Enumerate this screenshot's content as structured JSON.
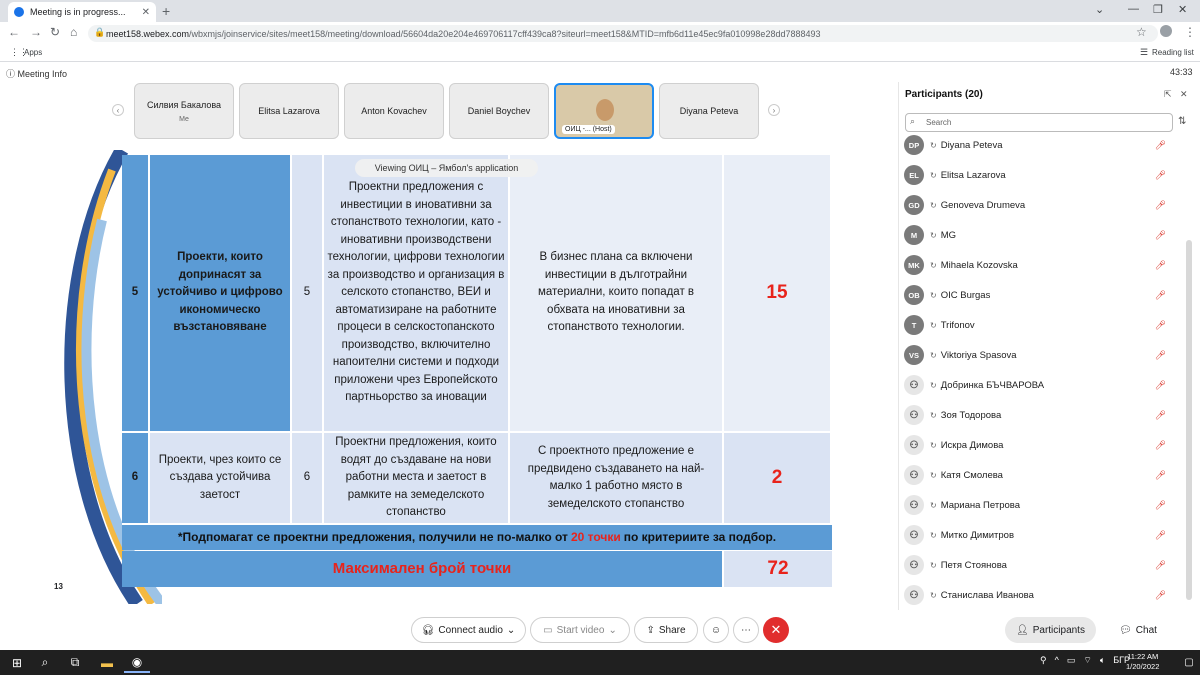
{
  "browser": {
    "tab_title": "Meeting is in progress...",
    "url_host": "meet158.webex.com",
    "url_path": "/wbxmjs/joinservice/sites/meet158/meeting/download/56604da20e204e469706117cff439ca8?siteurl=meet158&MTID=mfb6d11e45ec9fa010998e28dd7888493",
    "bookmarks_apps": "Apps",
    "reading_list": "Reading list"
  },
  "meeting": {
    "info_label": "Meeting Info",
    "timer": "43:33",
    "viewing_banner": "Viewing ОИЦ – Ямбол's application"
  },
  "thumbnails": [
    {
      "name": "Силвия Бакалова",
      "sub": "Me"
    },
    {
      "name": "Elitsa Lazarova",
      "sub": ""
    },
    {
      "name": "Anton Kovachev",
      "sub": ""
    },
    {
      "name": "Daniel Boychev",
      "sub": ""
    },
    {
      "name": "ОИЦ -... (Host)",
      "sub": ""
    },
    {
      "name": "Diyana Peteva",
      "sub": ""
    }
  ],
  "slide": {
    "row5": {
      "num": "5",
      "title": "Проекти, които допринасят за устойчиво и цифрово икономическо възстановяване",
      "sub": "5",
      "top_fragment": "Проектни предложения с",
      "desc": "инвестиции в иновативни за стопанството технологии, като - иновативни производствени технологии, цифрови технологии за производство и организация в селското стопанство, ВЕИ и автоматизиране на работните процеси в селскостопанското производство, включително напоителни системи и подходи приложени чрез Европейското партньорство за иновации",
      "condition": "В бизнес плана са включени инвестиции в дълготрайни материални, които попадат в обхвата на иновативни за стопанството технологии.",
      "points": "15"
    },
    "row6": {
      "num": "6",
      "title": "Проекти, чрез които се създава устойчива заетост",
      "sub": "6",
      "desc": "Проектни предложения, които водят до създаване на нови работни места и заетост в рамките на земеделското стопанство",
      "condition": "С проектното предложение е предвидено създаването на най-малко 1 работно място в земеделското стопанство",
      "points": "2"
    },
    "note_before": "*Подпомагат се проектни предложения, получили не по-малко от ",
    "note_highlight": "20 точки",
    "note_after": " по критериите за подбор.",
    "max_label": "Максимален брой точки",
    "max_value": "72",
    "page_number": "13"
  },
  "participants": {
    "title": "Participants (20)",
    "search_placeholder": "Search",
    "list": [
      {
        "initials": "DP",
        "name": "Diyana Peteva",
        "guest": false
      },
      {
        "initials": "EL",
        "name": "Elitsa Lazarova",
        "guest": false
      },
      {
        "initials": "GD",
        "name": "Genoveva Drumeva",
        "guest": false
      },
      {
        "initials": "M",
        "name": "MG",
        "guest": false
      },
      {
        "initials": "MK",
        "name": "Mihaela Kozovska",
        "guest": false
      },
      {
        "initials": "OB",
        "name": "OIC Burgas",
        "guest": false
      },
      {
        "initials": "T",
        "name": "Trifonov",
        "guest": false
      },
      {
        "initials": "VS",
        "name": "Viktoriya Spasova",
        "guest": false
      },
      {
        "initials": "",
        "name": "Добринка БЪЧВАРОВА",
        "guest": true
      },
      {
        "initials": "",
        "name": "Зоя Тодорова",
        "guest": true
      },
      {
        "initials": "",
        "name": "Искра Димова",
        "guest": true
      },
      {
        "initials": "",
        "name": "Катя Смолева",
        "guest": true
      },
      {
        "initials": "",
        "name": "Мариана Петрова",
        "guest": true
      },
      {
        "initials": "",
        "name": "Митко Димитров",
        "guest": true
      },
      {
        "initials": "",
        "name": "Петя Стоянова",
        "guest": true
      },
      {
        "initials": "",
        "name": "Станислава Иванова",
        "guest": true
      }
    ]
  },
  "controls": {
    "audio": "Connect audio",
    "video": "Start video",
    "share": "Share",
    "participants": "Participants",
    "chat": "Chat"
  },
  "taskbar": {
    "lang": "БГР",
    "time": "11:22 AM",
    "date": "1/20/2022"
  },
  "colors": {
    "slide_blue": "#5b9bd5",
    "slide_light": "#dae3f3",
    "points_red": "#e8231b",
    "end_red": "#e12d2d",
    "webex_accent": "#1d8bf1"
  }
}
